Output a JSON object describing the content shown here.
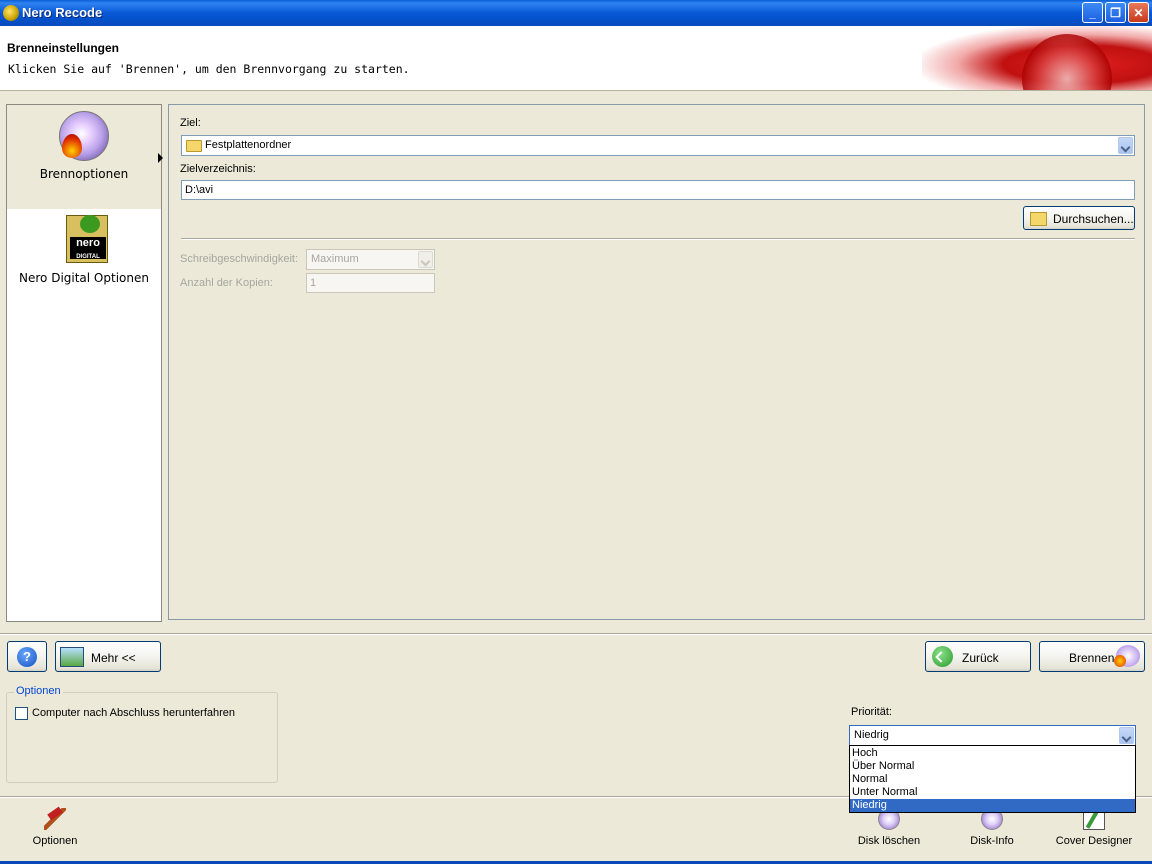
{
  "window": {
    "title": "Nero Recode",
    "controls": {
      "minimize": "minimize-icon",
      "restore": "restore-icon",
      "close": "close-icon"
    }
  },
  "header": {
    "title": "Brenneinstellungen",
    "subtitle": "Klicken Sie auf 'Brennen', um den Brennvorgang zu starten."
  },
  "nav": {
    "items": [
      {
        "label": "Brennoptionen",
        "icon": "burn-disc-icon",
        "active": true
      },
      {
        "label": "Nero Digital Optionen",
        "icon": "nero-digital-icon",
        "active": false
      }
    ]
  },
  "main": {
    "target_label": "Ziel:",
    "target_value": "Festplattenordner",
    "target_dir_label": "Zielverzeichnis:",
    "target_dir_value": "D:\\avi",
    "browse_label": "Durchsuchen...",
    "write_speed_label": "Schreibgeschwindigkeit:",
    "write_speed_value": "Maximum",
    "copies_label": "Anzahl der Kopien:",
    "copies_value": "1"
  },
  "buttons": {
    "more_label": "Mehr <<",
    "back_label": "Zurück",
    "burn_label": "Brennen"
  },
  "options": {
    "group_title": "Optionen",
    "shutdown_label": "Computer nach Abschluss herunterfahren",
    "shutdown_checked": false
  },
  "priority": {
    "label": "Priorität:",
    "value": "Niedrig",
    "options": [
      "Hoch",
      "Über Normal",
      "Normal",
      "Unter Normal",
      "Niedrig"
    ],
    "selected_index": 4
  },
  "toolbar": {
    "options_label": "Optionen",
    "erase_label": "Disk löschen",
    "info_label": "Disk-Info",
    "cover_label": "Cover Designer"
  },
  "colors": {
    "titlebar": "#0a5fd8",
    "selection": "#316ac5",
    "group_title": "#0046d5"
  }
}
